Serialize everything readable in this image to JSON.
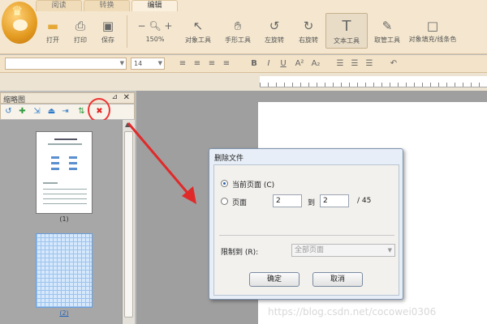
{
  "tabs": [
    {
      "label": "阅读"
    },
    {
      "label": "转换"
    },
    {
      "label": "编辑"
    }
  ],
  "ribbon": {
    "open": "打开",
    "print": "打印",
    "save": "保存",
    "zoom": "150%",
    "object_tool": "对象工具",
    "hand_tool": "手形工具",
    "rotate_left": "左旋转",
    "rotate_right": "右旋转",
    "text_tool": "文本工具",
    "eyedropper": "取管工具",
    "fill_tool": "对象填充/线条色"
  },
  "format_bar": {
    "font_size": "14"
  },
  "thumbnail_panel": {
    "title": "缩略图",
    "page1_label": "(1)",
    "page2_label": "(2)"
  },
  "dialog": {
    "title": "删除文件",
    "current_page": "当前页面 (C)",
    "pages": "页面",
    "from": "2",
    "to_label": "到",
    "to": "2",
    "total": "/ 45",
    "restrict_label": "限制到 (R):",
    "restrict_value": "全部页面",
    "ok": "确定",
    "cancel": "取消"
  },
  "watermark": "https://blog.csdn.net/cocowei0306",
  "colors": {
    "ribbon_bg": "#f5e7cf",
    "accent_red": "#e33333",
    "dialog_bg": "#e7eef7"
  }
}
